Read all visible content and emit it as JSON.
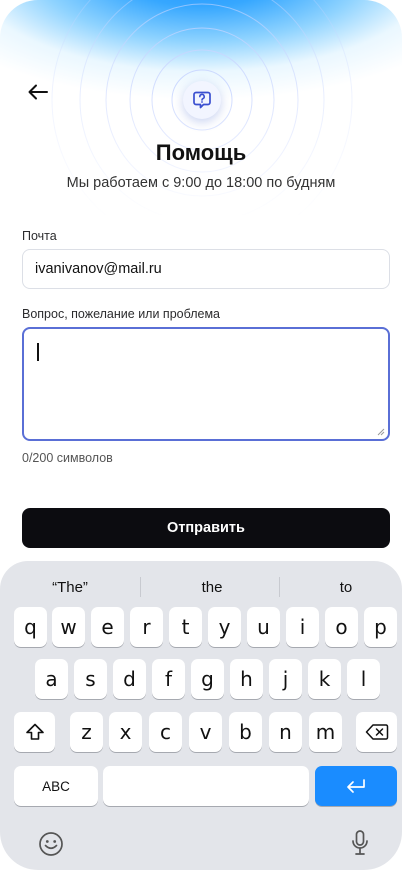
{
  "header": {
    "back_icon": "arrow-left-icon",
    "badge_icon": "question-chat-icon",
    "title": "Помощь",
    "subtitle": "Мы работаем с 9:00 до 18:00 по будням"
  },
  "form": {
    "email_label": "Почта",
    "email_value": "ivanivanov@mail.ru",
    "question_label": "Вопрос, пожелание или проблема",
    "question_value": "",
    "counter": "0/200 символов",
    "submit_label": "Отправить"
  },
  "keyboard": {
    "suggestions": [
      "“The”",
      "the",
      "to"
    ],
    "row1": [
      "q",
      "w",
      "e",
      "r",
      "t",
      "y",
      "u",
      "i",
      "o",
      "p"
    ],
    "row2": [
      "a",
      "s",
      "d",
      "f",
      "g",
      "h",
      "j",
      "k",
      "l"
    ],
    "row3": [
      "z",
      "x",
      "c",
      "v",
      "b",
      "n",
      "m"
    ],
    "abc_label": "ABC",
    "icons": {
      "shift": "shift-icon",
      "delete": "backspace-icon",
      "return": "return-icon",
      "emoji": "emoji-icon",
      "mic": "microphone-icon"
    }
  },
  "colors": {
    "accent_blue": "#1a8cff",
    "focus_border": "#5a6fd6",
    "button_dark": "#0c0c10",
    "keyboard_bg": "#e3e5ea"
  }
}
